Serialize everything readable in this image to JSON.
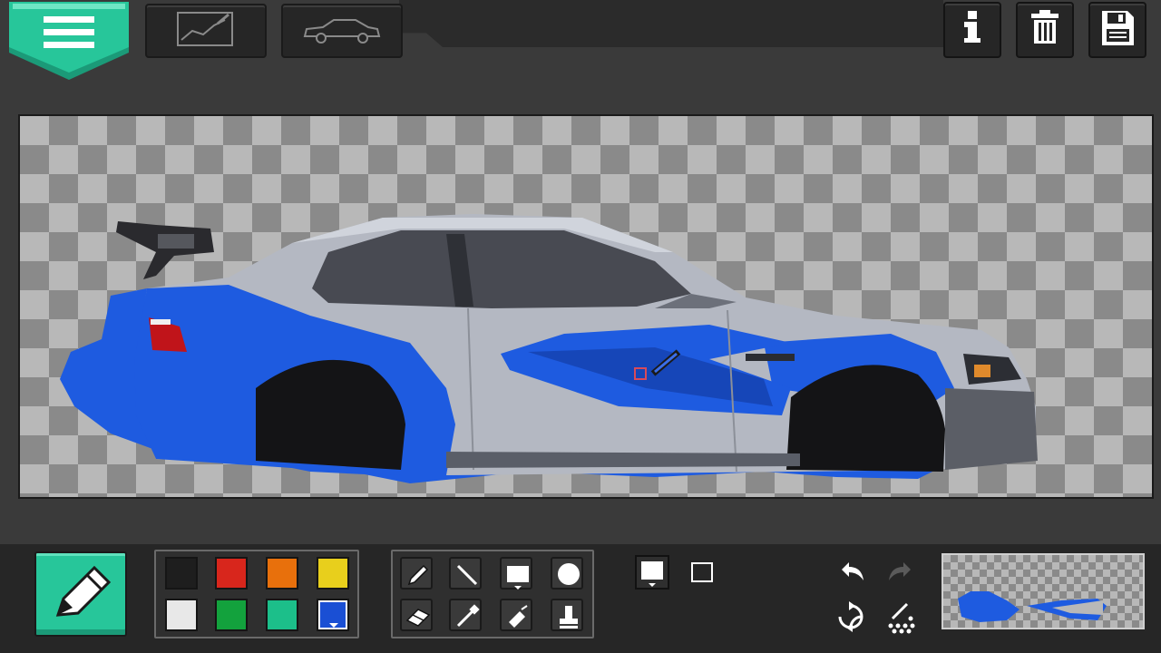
{
  "colors": {
    "accent": "#27c69a",
    "body_blue": "#1e5be0",
    "car_silver": "#b4b8c2",
    "panel": "#262626"
  },
  "header": {
    "menu_icon": "hamburger-icon",
    "tabs": [
      {
        "id": "editor",
        "icon": "sketch-editor-icon"
      },
      {
        "id": "car",
        "icon": "car-outline-icon"
      }
    ],
    "actions": [
      {
        "id": "info",
        "icon": "info-icon"
      },
      {
        "id": "trash",
        "icon": "trash-icon"
      },
      {
        "id": "save",
        "icon": "floppy-disk-icon"
      }
    ]
  },
  "palette": {
    "selected_index": 7,
    "swatches": [
      "#1e1e1e",
      "#d8261c",
      "#e8700c",
      "#e8cf1c",
      "#e8e8e8",
      "#13a23d",
      "#1cbf8a",
      "#1a4fd4"
    ]
  },
  "tools": {
    "selected": "rectangle",
    "items": [
      "pencil",
      "line",
      "rectangle",
      "circle",
      "eraser",
      "eyedropper",
      "spray",
      "stamp"
    ]
  },
  "shape_mode": {
    "options": [
      "filled",
      "outline"
    ],
    "selected": "filled"
  },
  "history": {
    "undo_enabled": true,
    "redo_enabled": false
  }
}
